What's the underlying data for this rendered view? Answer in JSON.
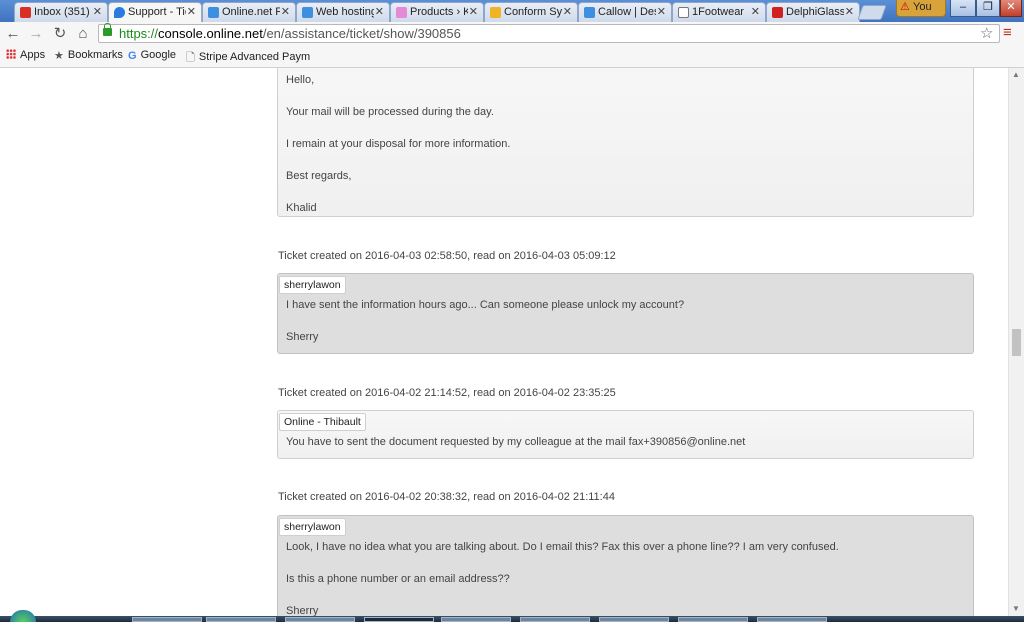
{
  "tabs": [
    {
      "title": "Inbox (351)",
      "favicon_color": "#d93025",
      "close": "✕",
      "active": false
    },
    {
      "title": "Support - Ticket",
      "favicon_color": "#2a7be0",
      "close": "✕",
      "active": true
    },
    {
      "title": "Online.net Free",
      "favicon_color": "#3d8fe0",
      "close": "✕",
      "active": false
    },
    {
      "title": "Web hosting",
      "favicon_color": "#3d8fe0",
      "close": "✕",
      "active": false
    },
    {
      "title": "Products › Kickstarter",
      "favicon_color": "#e58ad6",
      "close": "✕",
      "active": false
    },
    {
      "title": "Conform Systems",
      "favicon_color": "#f0b323",
      "close": "✕",
      "active": false
    },
    {
      "title": "Callow | Design",
      "favicon_color": "#3d8fe0",
      "close": "✕",
      "active": false
    },
    {
      "title": "1Footwear",
      "favicon_color": "#777777",
      "close": "✕",
      "active": false
    },
    {
      "title": "DelphiGlass",
      "favicon_color": "#d02020",
      "close": "✕",
      "active": false
    }
  ],
  "profile": {
    "warning": "⚠",
    "label": "You"
  },
  "window_buttons": {
    "minimize": "–",
    "maximize": "❐",
    "close": "✕"
  },
  "toolbar": {
    "back": "←",
    "forward": "→",
    "reload": "↻",
    "home": "⌂",
    "url_scheme": "https://",
    "url_host": "console.online.net",
    "url_path": "/en/assistance/ticket/show/390856",
    "star": "☆",
    "menu": "≡"
  },
  "bookmarks": [
    {
      "label": "Apps",
      "icon": "apps-grid-icon"
    },
    {
      "label": "Bookmarks",
      "icon": "star-icon",
      "glyph": "★"
    },
    {
      "label": "Google",
      "icon": "google-icon",
      "glyph": "G"
    },
    {
      "label": "Stripe Advanced Paym",
      "icon": "page-icon",
      "glyph": "🗋"
    }
  ],
  "messages": [
    {
      "type": "staff",
      "lines": [
        "Hello,",
        "Your mail will be processed during the day.",
        "I remain at your disposal for more information.",
        "Best regards,",
        "Khalid"
      ]
    },
    {
      "meta": "Ticket created on 2016-04-03 02:58:50, read on 2016-04-03 05:09:12",
      "type": "client",
      "author": "sherrylawon",
      "lines": [
        "I have sent the information hours ago... Can someone please unlock my account?",
        "Sherry"
      ]
    },
    {
      "meta": "Ticket created on 2016-04-02 21:14:52, read on 2016-04-02 23:35:25",
      "type": "staff",
      "author": "Online - Thibault",
      "lines": [
        "You have to sent the document requested by my colleague at the mail fax+390856@online.net"
      ]
    },
    {
      "meta": "Ticket created on 2016-04-02 20:38:32, read on 2016-04-02 21:11:44",
      "type": "client",
      "author": "sherrylawon",
      "lines": [
        "Look, I have no idea what you are talking about. Do I email this? Fax this over a phone line?? I am very confused.",
        "Is this a phone number or an email address??",
        "Sherry"
      ]
    }
  ],
  "scrollbar": {
    "up": "▲",
    "down": "▼"
  }
}
